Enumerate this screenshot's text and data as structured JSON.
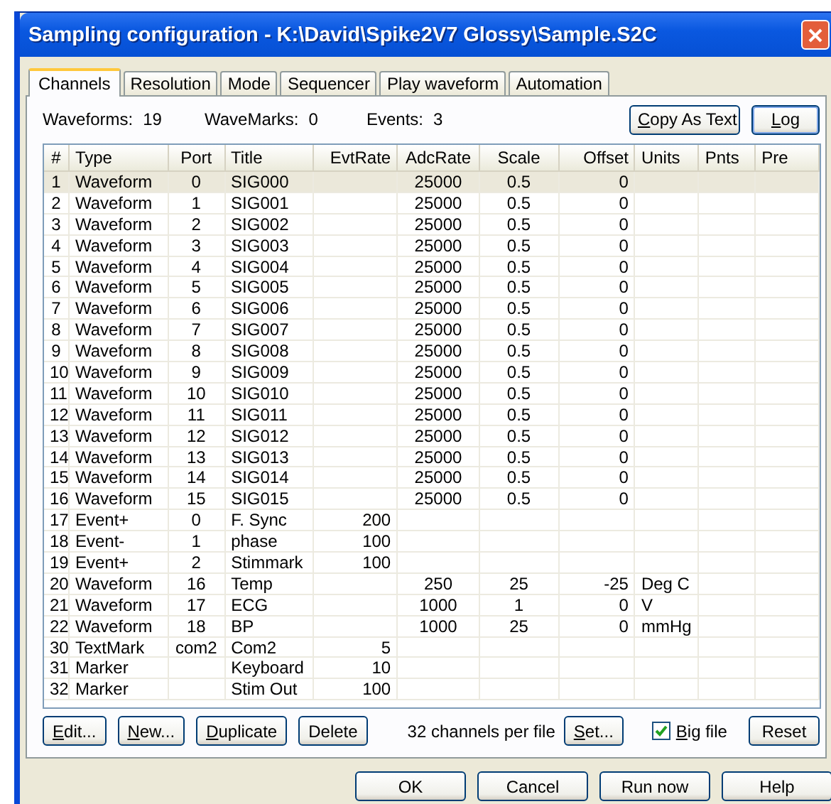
{
  "window": {
    "title": "Sampling configuration - K:\\David\\Spike2V7 Glossy\\Sample.S2C"
  },
  "tabs": [
    {
      "label": "Channels",
      "selected": true
    },
    {
      "label": "Resolution",
      "selected": false
    },
    {
      "label": "Mode",
      "selected": false
    },
    {
      "label": "Sequencer",
      "selected": false
    },
    {
      "label": "Play waveform",
      "selected": false
    },
    {
      "label": "Automation",
      "selected": false
    }
  ],
  "summary": [
    {
      "label": "Waveforms:",
      "value": "19"
    },
    {
      "label": "WaveMarks:",
      "value": "0"
    },
    {
      "label": "Events:",
      "value": "3"
    }
  ],
  "top_buttons": [
    {
      "label": "Copy As Text",
      "default": false
    },
    {
      "label": "Log",
      "default": true
    }
  ],
  "table": {
    "columns": [
      "#",
      "Type",
      "Port",
      "Title",
      "EvtRate",
      "AdcRate",
      "Scale",
      "Offset",
      "Units",
      "Pnts",
      "Pre"
    ],
    "rows": [
      {
        "selected": true,
        "cells": [
          "1",
          "Waveform",
          "0",
          "SIG000",
          null,
          "25000",
          "0.5",
          "0",
          null,
          null,
          null
        ]
      },
      {
        "selected": false,
        "cells": [
          "2",
          "Waveform",
          "1",
          "SIG001",
          null,
          "25000",
          "0.5",
          "0",
          null,
          null,
          null
        ]
      },
      {
        "selected": false,
        "cells": [
          "3",
          "Waveform",
          "2",
          "SIG002",
          null,
          "25000",
          "0.5",
          "0",
          null,
          null,
          null
        ]
      },
      {
        "selected": false,
        "cells": [
          "4",
          "Waveform",
          "3",
          "SIG003",
          null,
          "25000",
          "0.5",
          "0",
          null,
          null,
          null
        ]
      },
      {
        "selected": false,
        "cells": [
          "5",
          "Waveform",
          "4",
          "SIG004",
          null,
          "25000",
          "0.5",
          "0",
          null,
          null,
          null
        ]
      },
      {
        "selected": false,
        "cells": [
          "6",
          "Waveform",
          "5",
          "SIG005",
          null,
          "25000",
          "0.5",
          "0",
          null,
          null,
          null
        ]
      },
      {
        "selected": false,
        "cells": [
          "7",
          "Waveform",
          "6",
          "SIG006",
          null,
          "25000",
          "0.5",
          "0",
          null,
          null,
          null
        ]
      },
      {
        "selected": false,
        "cells": [
          "8",
          "Waveform",
          "7",
          "SIG007",
          null,
          "25000",
          "0.5",
          "0",
          null,
          null,
          null
        ]
      },
      {
        "selected": false,
        "cells": [
          "9",
          "Waveform",
          "8",
          "SIG008",
          null,
          "25000",
          "0.5",
          "0",
          null,
          null,
          null
        ]
      },
      {
        "selected": false,
        "cells": [
          "10",
          "Waveform",
          "9",
          "SIG009",
          null,
          "25000",
          "0.5",
          "0",
          null,
          null,
          null
        ]
      },
      {
        "selected": false,
        "cells": [
          "11",
          "Waveform",
          "10",
          "SIG010",
          null,
          "25000",
          "0.5",
          "0",
          null,
          null,
          null
        ]
      },
      {
        "selected": false,
        "cells": [
          "12",
          "Waveform",
          "11",
          "SIG011",
          null,
          "25000",
          "0.5",
          "0",
          null,
          null,
          null
        ]
      },
      {
        "selected": false,
        "cells": [
          "13",
          "Waveform",
          "12",
          "SIG012",
          null,
          "25000",
          "0.5",
          "0",
          null,
          null,
          null
        ]
      },
      {
        "selected": false,
        "cells": [
          "14",
          "Waveform",
          "13",
          "SIG013",
          null,
          "25000",
          "0.5",
          "0",
          null,
          null,
          null
        ]
      },
      {
        "selected": false,
        "cells": [
          "15",
          "Waveform",
          "14",
          "SIG014",
          null,
          "25000",
          "0.5",
          "0",
          null,
          null,
          null
        ]
      },
      {
        "selected": false,
        "cells": [
          "16",
          "Waveform",
          "15",
          "SIG015",
          null,
          "25000",
          "0.5",
          "0",
          null,
          null,
          null
        ]
      },
      {
        "selected": false,
        "cells": [
          "17",
          "Event+",
          "0",
          "F. Sync",
          "200",
          null,
          null,
          null,
          null,
          null,
          null
        ]
      },
      {
        "selected": false,
        "cells": [
          "18",
          "Event-",
          "1",
          "phase",
          "100",
          null,
          null,
          null,
          null,
          null,
          null
        ]
      },
      {
        "selected": false,
        "cells": [
          "19",
          "Event+",
          "2",
          "Stimmark",
          "100",
          null,
          null,
          null,
          null,
          null,
          null
        ]
      },
      {
        "selected": false,
        "cells": [
          "20",
          "Waveform",
          "16",
          "Temp",
          null,
          "250",
          "25",
          "-25",
          "Deg C",
          null,
          null
        ]
      },
      {
        "selected": false,
        "cells": [
          "21",
          "Waveform",
          "17",
          "ECG",
          null,
          "1000",
          "1",
          "0",
          "V",
          null,
          null
        ]
      },
      {
        "selected": false,
        "cells": [
          "22",
          "Waveform",
          "18",
          "BP",
          null,
          "1000",
          "25",
          "0",
          "mmHg",
          null,
          null
        ]
      },
      {
        "selected": false,
        "cells": [
          "30",
          "TextMark",
          "com2",
          "Com2",
          "5",
          null,
          null,
          null,
          null,
          null,
          null
        ]
      },
      {
        "selected": false,
        "cells": [
          "31",
          "Marker",
          null,
          "Keyboard",
          "10",
          null,
          null,
          null,
          null,
          null,
          null
        ]
      },
      {
        "selected": false,
        "cells": [
          "32",
          "Marker",
          null,
          "Stim Out",
          "100",
          null,
          null,
          null,
          null,
          null,
          null
        ]
      }
    ]
  },
  "row_buttons": [
    "Edit...",
    "New...",
    "Duplicate",
    "Delete"
  ],
  "channels_per_file": "32 channels per file",
  "set_button": "Set...",
  "big_file": {
    "label": "Big file",
    "checked": true
  },
  "reset_button": "Reset",
  "dialog_buttons": [
    "OK",
    "Cancel",
    "Run now",
    "Help"
  ]
}
